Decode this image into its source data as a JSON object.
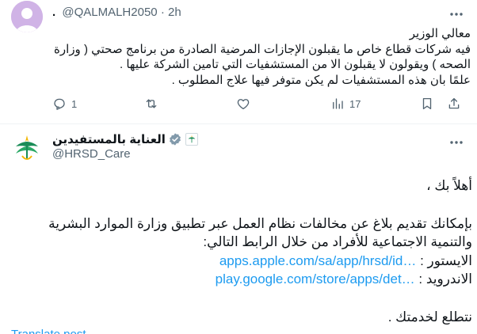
{
  "reply": {
    "author_prefix": ".",
    "handle": "@QALMALH2050",
    "separator": "·",
    "time": "2h",
    "lines": [
      "معالي الوزير",
      "فيه شركات قطاع خاص ما يقبلون الإجازات المرضية الصادرة من برنامج صحتي ( وزارة",
      "الصحه ) ويقولون لا يقبلون الا من المستشفيات التي تامين الشركة عليها .",
      "علمًا بان هذه المستشفيات لم يكن متوفر فيها علاج المطلوب ."
    ],
    "actions": {
      "reply_count": "1",
      "retweet_count": "",
      "like_count": "",
      "views_count": "17"
    },
    "avatar_color": "#d0b3e6"
  },
  "main": {
    "author_name": "العناية بالمستفيدين",
    "handle": "@HRSD_Care",
    "greeting": "أهلاً بك ،",
    "paragraph_line1": "بإمكانك تقديم بلاغ عن مخالفات نظام العمل عبر تطبيق وزارة الموارد البشرية",
    "paragraph_line2": "والتنمية الاجتماعية للأفراد من خلال الرابط التالي:",
    "ios_label": "الايستور :",
    "ios_link": "apps.apple.com/sa/app/hrsd/id…",
    "android_label": "الاندرويد :",
    "android_link": "play.google.com/store/apps/det…",
    "closing": "نتطلع لخدمتك .",
    "translate_partial": "Translate post"
  },
  "colors": {
    "link": "#1d9bf0",
    "muted": "#536471",
    "verified": "#829aab",
    "logo_green": "#1a8c57",
    "logo_yellow": "#f2b705"
  }
}
